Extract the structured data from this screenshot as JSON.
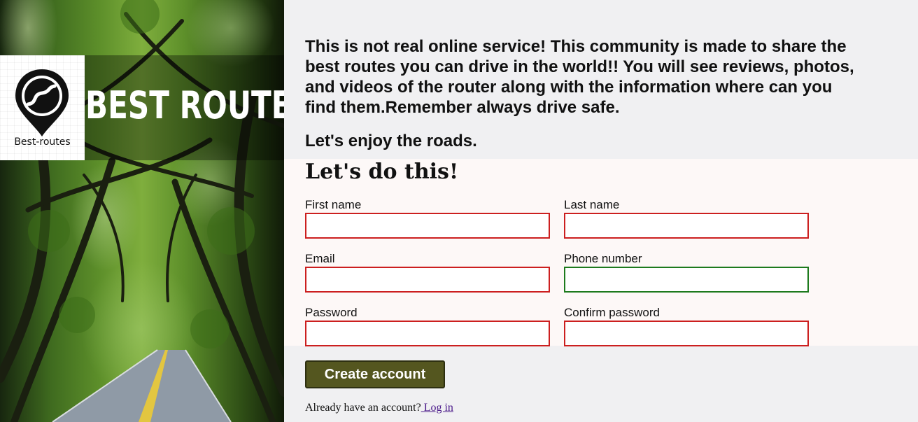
{
  "brand": {
    "title": "BEST ROUTES",
    "logo_caption": "Best-routes",
    "logo_icon": "map-pin-road-icon"
  },
  "intro": {
    "description": "This is not real online service! This community is made to share the best routes you can drive in the world!! You will see reviews, photos, and videos of the router along with the information where can you find them.Remember always drive safe.",
    "tagline": "Let's enjoy the roads."
  },
  "form": {
    "title": "Let's do this!",
    "fields": {
      "first_name": {
        "label": "First name",
        "value": "",
        "state": "invalid"
      },
      "last_name": {
        "label": "Last name",
        "value": "",
        "state": "invalid"
      },
      "email": {
        "label": "Email",
        "value": "",
        "state": "invalid"
      },
      "phone": {
        "label": "Phone number",
        "value": "",
        "state": "valid"
      },
      "password": {
        "label": "Password",
        "value": "",
        "state": "invalid"
      },
      "confirm_password": {
        "label": "Confirm password",
        "value": "",
        "state": "invalid"
      }
    },
    "submit_label": "Create account",
    "login_prompt": "Already have an account?",
    "login_link": " Log in"
  },
  "colors": {
    "invalid_border": "#cc1f1f",
    "valid_border": "#1d7a1d",
    "button_bg": "#54561f",
    "panel_bg": "#f0f0f2",
    "form_bg": "#fdf8f7"
  }
}
